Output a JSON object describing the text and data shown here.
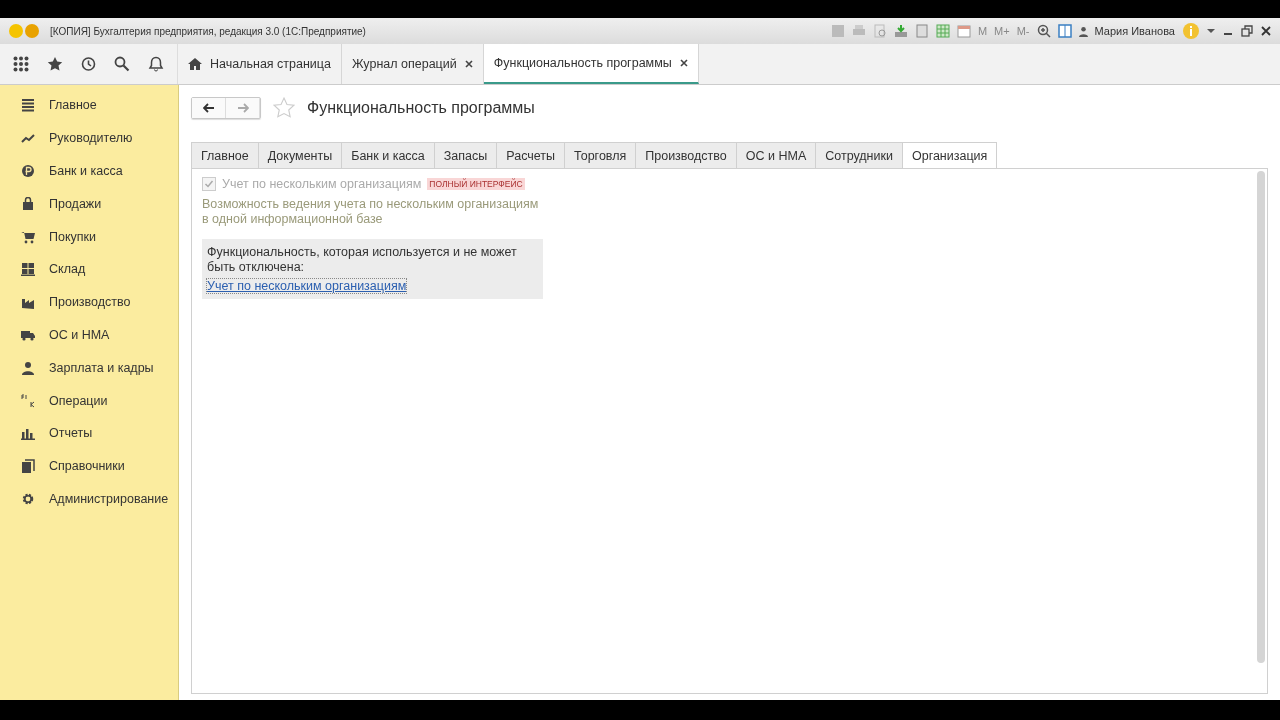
{
  "window": {
    "title": "[КОПИЯ] Бухгалтерия предприятия, редакция 3.0  (1С:Предприятие)",
    "memory_buttons": [
      "M",
      "M+",
      "M-"
    ],
    "user": "Мария Иванова"
  },
  "open_tabs": [
    {
      "label": "Начальная страница",
      "kind": "home",
      "selected": false
    },
    {
      "label": "Журнал операций",
      "kind": "page",
      "selected": false
    },
    {
      "label": "Функциональность программы",
      "kind": "page",
      "selected": true
    }
  ],
  "sidebar": {
    "items": [
      {
        "label": "Главное"
      },
      {
        "label": "Руководителю"
      },
      {
        "label": "Банк и касса"
      },
      {
        "label": "Продажи"
      },
      {
        "label": "Покупки"
      },
      {
        "label": "Склад"
      },
      {
        "label": "Производство"
      },
      {
        "label": "ОС и НМА"
      },
      {
        "label": "Зарплата и кадры"
      },
      {
        "label": "Операции"
      },
      {
        "label": "Отчеты"
      },
      {
        "label": "Справочники"
      },
      {
        "label": "Администрирование"
      }
    ]
  },
  "form": {
    "title": "Функциональность программы",
    "tabs": [
      {
        "label": "Главное",
        "selected": false
      },
      {
        "label": "Документы",
        "selected": false
      },
      {
        "label": "Банк и касса",
        "selected": false
      },
      {
        "label": "Запасы",
        "selected": false
      },
      {
        "label": "Расчеты",
        "selected": false
      },
      {
        "label": "Торговля",
        "selected": false
      },
      {
        "label": "Производство",
        "selected": false
      },
      {
        "label": "ОС и НМА",
        "selected": false
      },
      {
        "label": "Сотрудники",
        "selected": false
      },
      {
        "label": "Организация",
        "selected": true
      }
    ],
    "option": {
      "label": "Учет по нескольким организациям",
      "checked": true,
      "disabled": true,
      "badge": "ПОЛНЫЙ ИНТЕРФЕЙС",
      "description": "Возможность ведения учета по нескольким организациям в одной информационной базе"
    },
    "notice": {
      "text": "Функциональность, которая используется и не может быть отключена:",
      "link": "Учет по нескольким организациям"
    }
  }
}
